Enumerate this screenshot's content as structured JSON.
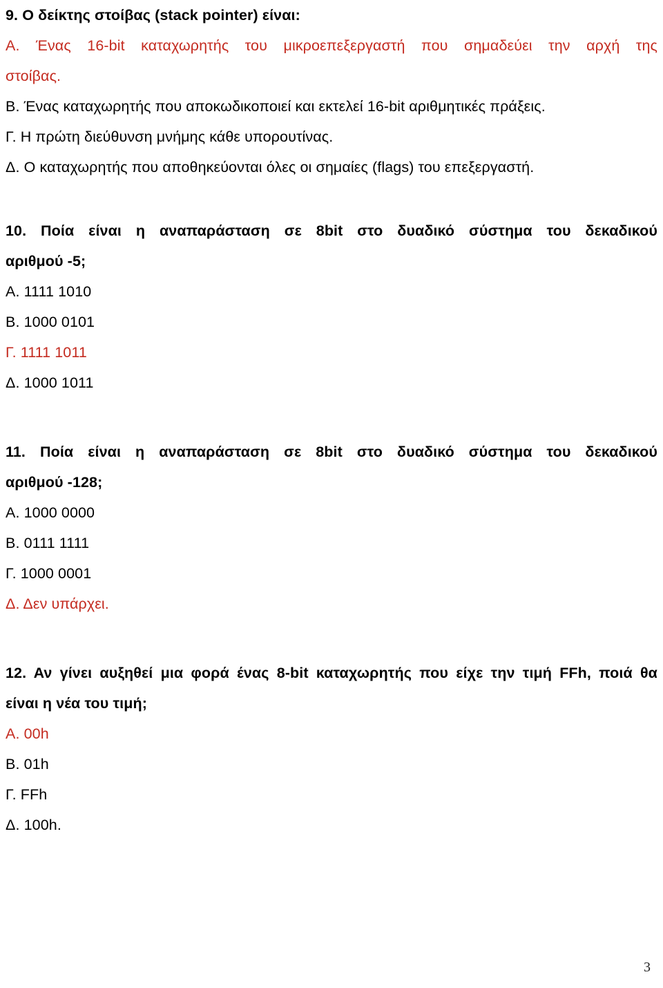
{
  "document": {
    "page_number": "3",
    "colors": {
      "answer_highlight": "#C42B20",
      "text": "#000000",
      "background": "#FFFFFF"
    }
  },
  "questions": [
    {
      "number": "9",
      "heading": "9. Ο δείκτης στοίβας (stack pointer) είναι:",
      "heading_lines": [
        "9. Ο δείκτης στοίβας (stack pointer) είναι:"
      ],
      "options": [
        {
          "label": "Α.",
          "text": "Α. Ένας 16-bit καταχωρητής του μικροεπεξεργαστή που σημαδεύει την αρχή της στοίβας.",
          "line1": "Α. Ένας 16-bit καταχωρητής του μικροεπεξεργαστή που σημαδεύει την αρχή της",
          "line2": "στοίβας.",
          "highlighted": true
        },
        {
          "label": "Β.",
          "text": "Β. Ένας καταχωρητής που αποκωδικοποιεί και εκτελεί 16-bit αριθμητικές πράξεις.",
          "highlighted": false
        },
        {
          "label": "Γ.",
          "text": "Γ. Η πρώτη διεύθυνση μνήμης κάθε υπορουτίνας.",
          "highlighted": false
        },
        {
          "label": "Δ.",
          "text": "Δ. Ο καταχωρητής που αποθηκεύονται όλες οι σημαίες (flags) του επεξεργαστή.",
          "highlighted": false
        }
      ]
    },
    {
      "number": "10",
      "heading": "10. Ποία είναι η αναπαράσταση σε 8bit στο δυαδικό σύστημα του δεκαδικού αριθμού -5;",
      "heading_line1": "10. Ποία είναι η αναπαράσταση σε 8bit στο δυαδικό σύστημα του δεκαδικού",
      "heading_line2": "αριθμού -5;",
      "options": [
        {
          "label": "Α.",
          "text": "Α. 1111 1010",
          "highlighted": false
        },
        {
          "label": "Β.",
          "text": "Β. 1000 0101",
          "highlighted": false
        },
        {
          "label": "Γ.",
          "text": "Γ. 1111 1011",
          "highlighted": true
        },
        {
          "label": "Δ.",
          "text": "Δ. 1000 1011",
          "highlighted": false
        }
      ]
    },
    {
      "number": "11",
      "heading": "11. Ποία είναι η αναπαράσταση σε 8bit στο δυαδικό σύστημα του δεκαδικού αριθμού -128;",
      "heading_line1": "11. Ποία είναι η αναπαράσταση σε 8bit στο δυαδικό σύστημα του δεκαδικού",
      "heading_line2": "αριθμού -128;",
      "options": [
        {
          "label": "Α.",
          "text": "Α. 1000 0000",
          "highlighted": false
        },
        {
          "label": "Β.",
          "text": "Β. 0111 1111",
          "highlighted": false
        },
        {
          "label": "Γ.",
          "text": "Γ. 1000 0001",
          "highlighted": false
        },
        {
          "label": "Δ.",
          "text": "Δ. Δεν υπάρχει.",
          "highlighted": true
        }
      ]
    },
    {
      "number": "12",
      "heading": "12. Αν γίνει αυξηθεί μια φορά ένας 8-bit καταχωρητής που είχε την τιμή FFh, ποιά θα είναι η νέα του τιμή;",
      "heading_line1": "12. Αν γίνει αυξηθεί μια φορά ένας 8-bit καταχωρητής που είχε την τιμή FFh, ποιά θα",
      "heading_line2": "είναι η νέα του τιμή;",
      "options": [
        {
          "label": "Α.",
          "text": "Α. 00h",
          "highlighted": true
        },
        {
          "label": "Β.",
          "text": "Β. 01h",
          "highlighted": false
        },
        {
          "label": "Γ.",
          "text": "Γ. FFh",
          "highlighted": false
        },
        {
          "label": "Δ.",
          "text": "Δ. 100h.",
          "highlighted": false
        }
      ]
    }
  ]
}
